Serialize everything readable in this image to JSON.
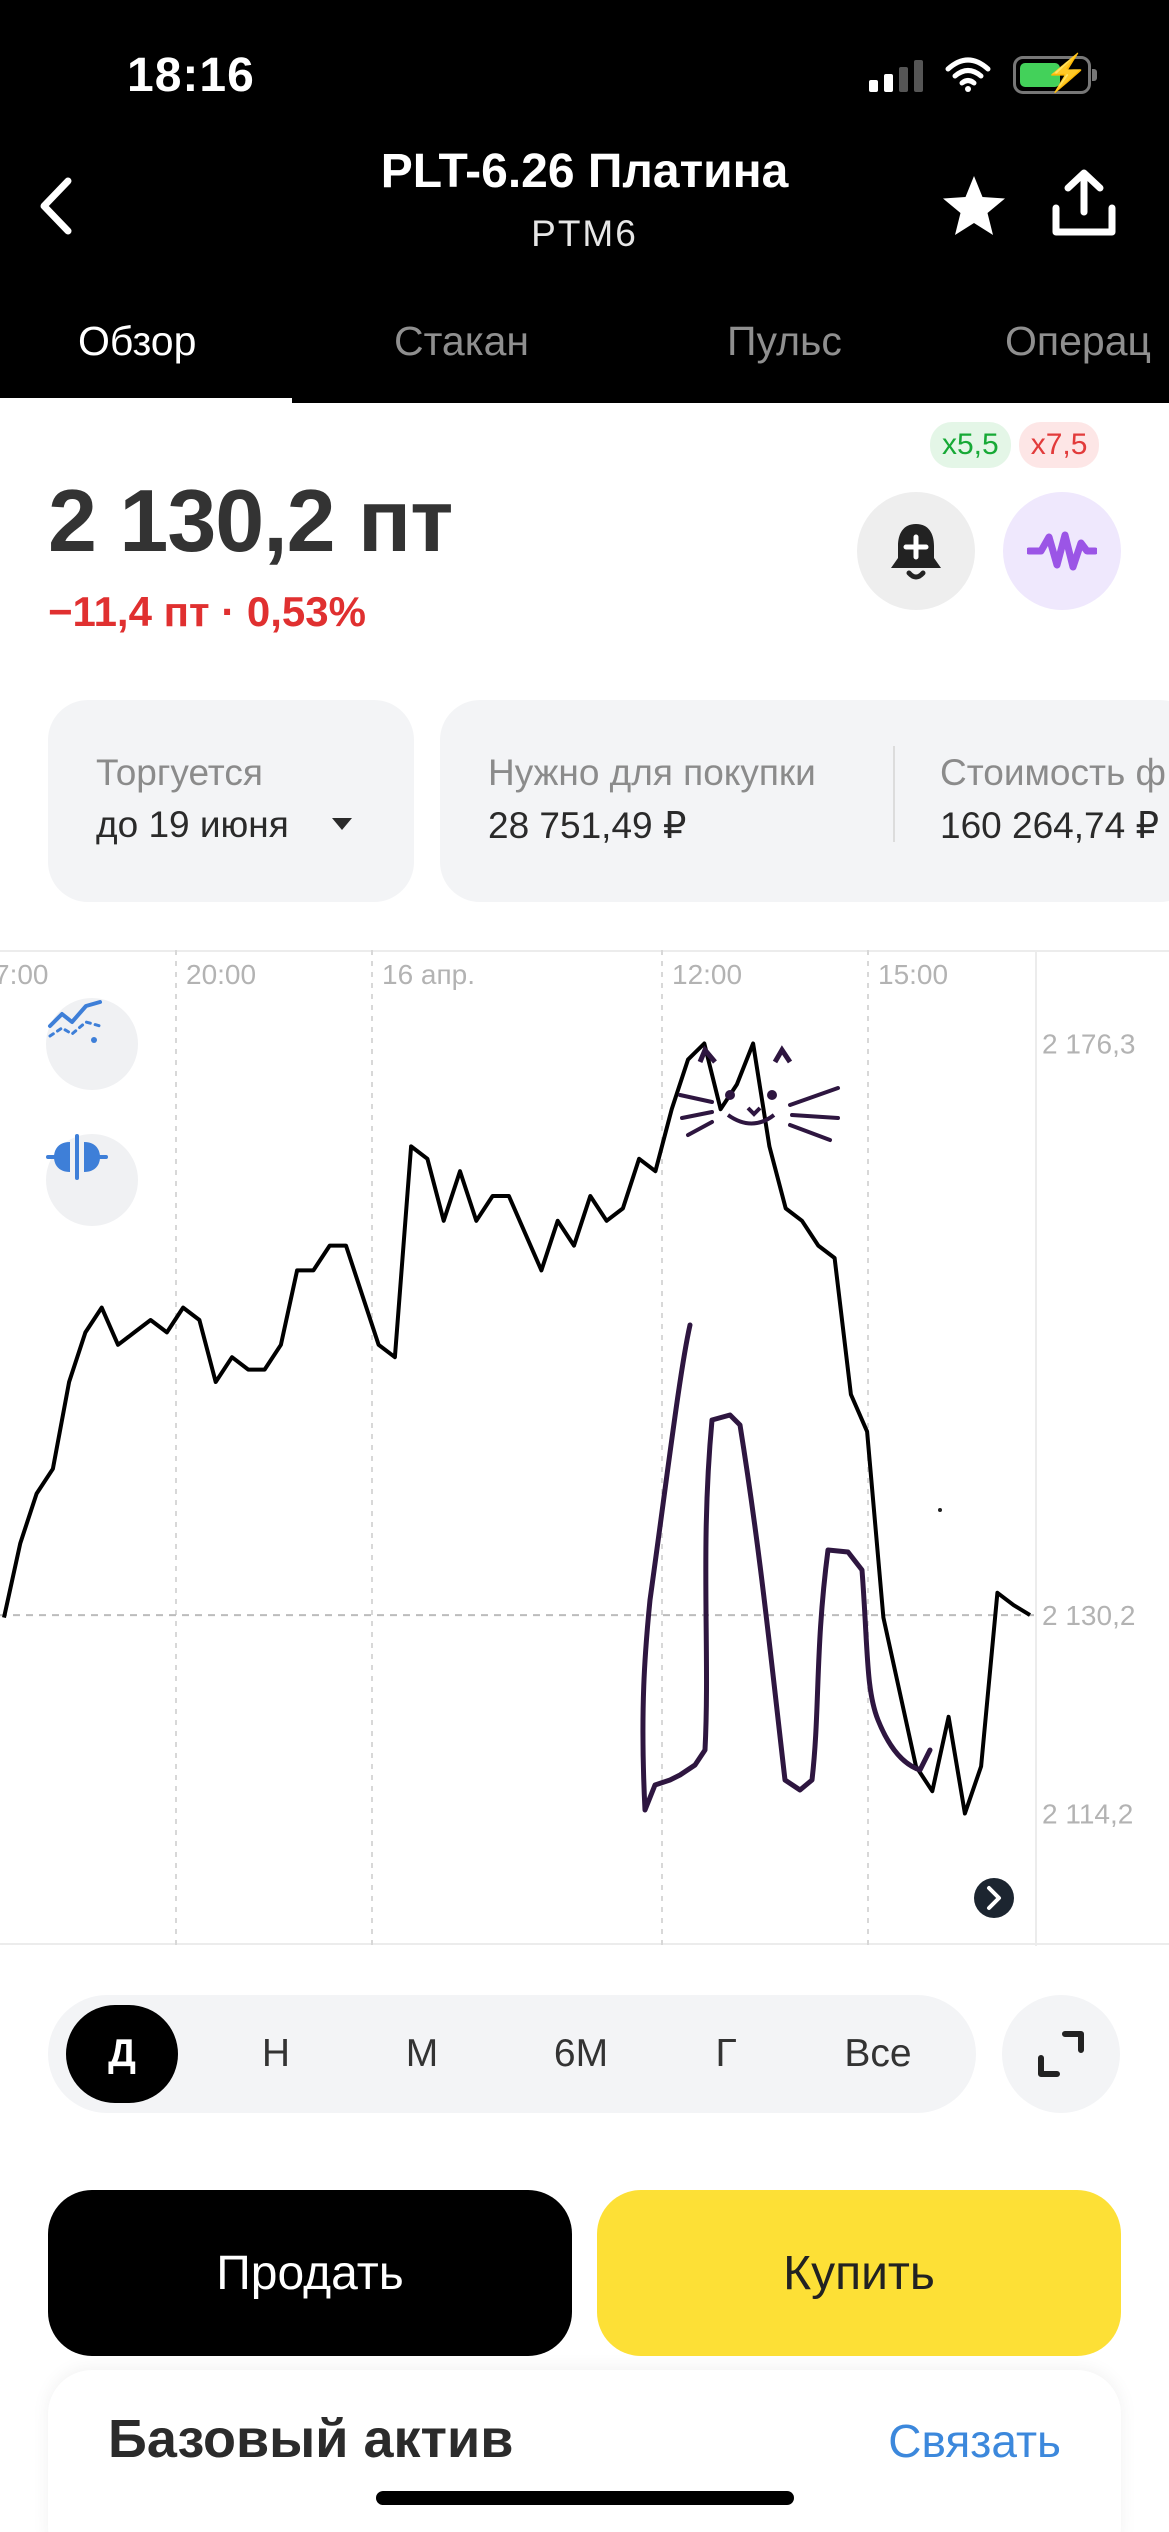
{
  "status_bar": {
    "time": "18:16"
  },
  "header": {
    "title": "PLT-6.26 Платина",
    "ticker": "PTM6",
    "icons": {
      "back": "chevron-left-icon",
      "favorite": "star-icon",
      "share": "share-icon"
    }
  },
  "tabs": [
    {
      "label": "Обзор",
      "active": true
    },
    {
      "label": "Стакан",
      "active": false
    },
    {
      "label": "Пульс",
      "active": false
    },
    {
      "label": "Операц",
      "active": false
    }
  ],
  "price": {
    "value": "2 130,2 пт",
    "change": "−11,4 пт · 0,53%",
    "leverage_long": "х5,5",
    "leverage_short": "х7,5"
  },
  "info_cards": {
    "trading": {
      "label": "Торгуется",
      "value": "до 19 июня"
    },
    "required": {
      "label": "Нужно для покупки",
      "value": "28 751,49 ₽"
    },
    "cost": {
      "label": "Стоимость ф",
      "value": "160 264,74 ₽"
    }
  },
  "chart_data": {
    "type": "line",
    "x_ticks": [
      "7:00",
      "20:00",
      "16 апр.",
      "12:00",
      "15:00"
    ],
    "y_ticks": [
      "2 176,3",
      "2 130,2",
      "2 114,2"
    ],
    "current_value": 2130.2,
    "ylim": [
      2104,
      2179
    ],
    "series": [
      {
        "values": [
          2130,
          2136,
          2140,
          2142,
          2149,
          2153,
          2155,
          2152,
          2153,
          2154,
          2153,
          2155,
          2154,
          2149,
          2151,
          2150,
          2150,
          2152,
          2158,
          2158,
          2160,
          2160,
          2156,
          2152,
          2151,
          2168,
          2167,
          2162,
          2166,
          2162,
          2164,
          2164,
          2161,
          2158,
          2162,
          2160,
          2164,
          2162,
          2163,
          2167,
          2166,
          2171,
          2175,
          2176.3,
          2171,
          2173,
          2176.3,
          2168,
          2163,
          2162,
          2160,
          2159,
          2148,
          2145,
          2130,
          2124,
          2118,
          2116,
          2122,
          2114.2,
          2118,
          2132,
          2131,
          2130.2
        ]
      }
    ],
    "grid": true,
    "line_color": "#000000",
    "current_line_color": "#bcbcbc"
  },
  "chart_tools": {
    "indicators": "indicators-icon",
    "compare": "compare-icon"
  },
  "periods": [
    "Д",
    "Н",
    "М",
    "6М",
    "Г",
    "Все"
  ],
  "actions": {
    "sell": "Продать",
    "buy": "Купить"
  },
  "base_asset": {
    "title": "Базовый актив",
    "link": "Связать"
  }
}
